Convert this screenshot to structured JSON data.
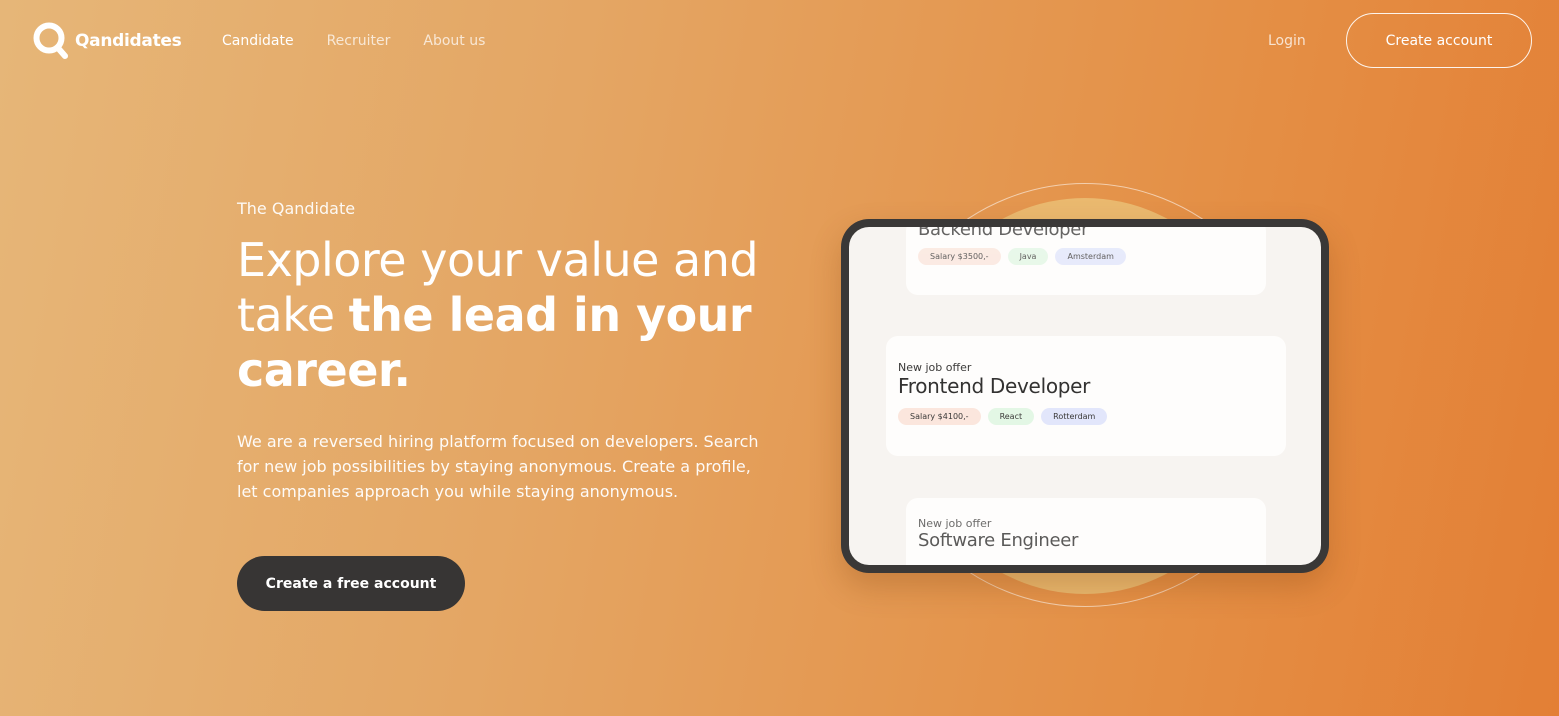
{
  "header": {
    "brand": "Qandidates",
    "nav": [
      {
        "label": "Candidate",
        "active": true
      },
      {
        "label": "Recruiter",
        "active": false
      },
      {
        "label": "About us",
        "active": false
      }
    ],
    "login_label": "Login",
    "create_account_label": "Create account"
  },
  "hero": {
    "eyebrow": "The Qandidate",
    "title_regular": "Explore your value and take ",
    "title_bold": "the lead in your career.",
    "description": "We are a reversed hiring platform focused on developers. Search for new job possibilities by staying anonymous. Create a profile, let companies approach you while staying anonymous.",
    "cta_label": "Create a free account"
  },
  "illustration": {
    "cards": [
      {
        "title": "Backend Developer",
        "tags": [
          {
            "label": "Salary $3500,-",
            "kind": "salary"
          },
          {
            "label": "Java",
            "kind": "skill"
          },
          {
            "label": "Amsterdam",
            "kind": "city"
          }
        ]
      },
      {
        "label": "New job offer",
        "title": "Frontend Developer",
        "tags": [
          {
            "label": "Salary $4100,-",
            "kind": "salary"
          },
          {
            "label": "React",
            "kind": "skill"
          },
          {
            "label": "Rotterdam",
            "kind": "city"
          }
        ]
      },
      {
        "label": "New job offer",
        "title": "Software Engineer"
      }
    ]
  },
  "colors": {
    "cta_background": "#373534",
    "tablet_frame": "#3a3837",
    "tag_salary": "#fbe6dd",
    "tag_skill": "#e3f7e5",
    "tag_city": "#e2e6fb"
  },
  "icons": {
    "logo": "q-logo-icon"
  }
}
